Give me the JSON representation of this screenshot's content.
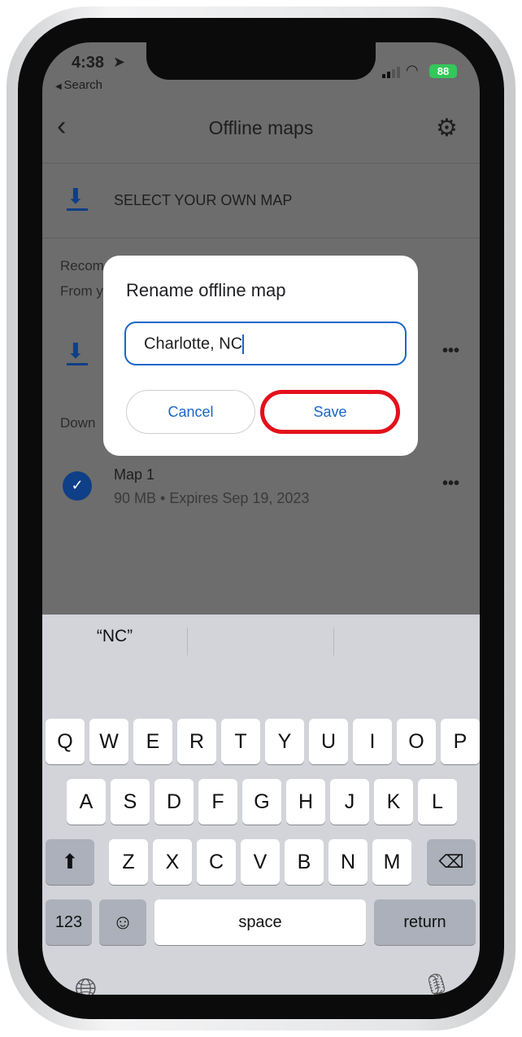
{
  "status": {
    "time": "4:38",
    "back_app": "Search",
    "battery": "88"
  },
  "header": {
    "title": "Offline maps"
  },
  "select_own_map": "SELECT YOUR OWN MAP",
  "recommended": {
    "title": "Recom",
    "subtitle": "From y"
  },
  "downloaded": {
    "title": "Down"
  },
  "maps": [
    {
      "name": "Map 1",
      "details": "90 MB • Expires Sep 19, 2023"
    }
  ],
  "dialog": {
    "title": "Rename offline map",
    "input_value": "Charlotte, NC",
    "cancel": "Cancel",
    "save": "Save"
  },
  "keyboard": {
    "suggestions": [
      "“NC”",
      "",
      ""
    ],
    "row1": [
      "Q",
      "W",
      "E",
      "R",
      "T",
      "Y",
      "U",
      "I",
      "O",
      "P"
    ],
    "row2": [
      "A",
      "S",
      "D",
      "F",
      "G",
      "H",
      "J",
      "K",
      "L"
    ],
    "row3": [
      "Z",
      "X",
      "C",
      "V",
      "B",
      "N",
      "M"
    ],
    "numbers": "123",
    "space": "space",
    "return": "return"
  },
  "colors": {
    "accent": "#1a66c9",
    "highlight": "#e3101a",
    "battery": "#34c759"
  }
}
